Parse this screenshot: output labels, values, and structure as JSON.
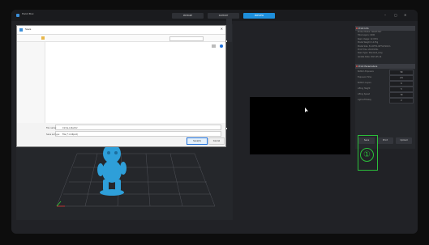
{
  "app": {
    "title": "Halot Box"
  },
  "nav_tabs": [
    {
      "label": "PREPARE",
      "active": false
    },
    {
      "label": "SUPPORT",
      "active": false
    },
    {
      "label": "PREVIEW",
      "active": true
    }
  ],
  "window_controls": {
    "minimize": "–",
    "maximize": "▢",
    "close": "✕"
  },
  "dialog": {
    "title": "Save",
    "close": "✕",
    "filename_label": "File name:",
    "filename_value": "Circle-collector",
    "filetype_label": "Save as type:",
    "filetype_value": "File (*.cxdlpv4)",
    "open_button": "Save(S)",
    "cancel_button": "Cancel"
  },
  "right_panel": {
    "print_info_title": "Print Info",
    "print_info_lines": [
      "Printer Model: HALOT-SKY",
      "Total Layers: 1090",
      "Resin Usage: 12.05ml",
      "Model Weight: 14.55g",
      "Model Size: 51.00*51.00*54.50mm",
      "Print Time: 2h22m55s",
      "Resin Type: Standard_Gray",
      "Update Date: 2021-05-14"
    ],
    "print_params_title": "Print Parameters",
    "params": [
      {
        "label": "Bottom Exposure",
        "value": "50"
      },
      {
        "label": "Exposure Time",
        "value": "2.5"
      },
      {
        "label": "Bottom Layers",
        "value": "6"
      },
      {
        "label": "Lifting Height",
        "value": "5"
      },
      {
        "label": "Lifting Speed",
        "value": "70"
      },
      {
        "label": "Light-off Delay",
        "value": "2"
      }
    ],
    "buttons": [
      "Save",
      "Print",
      "Upload"
    ]
  },
  "annotation": {
    "marker": "①",
    "color": "#2bbf3a"
  },
  "colors": {
    "accent": "#1e8fdc",
    "model": "#2e9fd9",
    "panel_bg": "#26282c"
  }
}
